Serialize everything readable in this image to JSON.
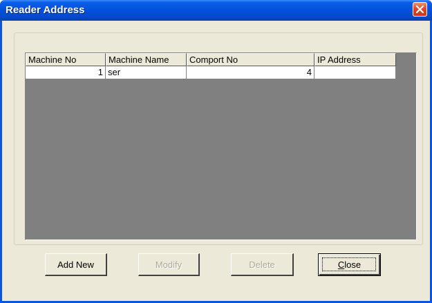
{
  "window": {
    "title": "Reader Address"
  },
  "icons": {
    "close": "close-x-icon"
  },
  "colors": {
    "titlebar": "#0450d8",
    "close_button": "#e0462a",
    "client_bg": "#ece9d8",
    "grid_bg": "#808080"
  },
  "grid": {
    "columns": [
      "Machine No",
      "Machine Name",
      "Comport No",
      "IP Address"
    ],
    "rows": [
      {
        "machine_no": "1",
        "machine_name": "ser",
        "comport_no": "4",
        "ip_address": ""
      }
    ]
  },
  "buttons": {
    "add_new": "Add New",
    "modify": "Modify",
    "delete": "Delete",
    "close_mnemonic": "C",
    "close_rest": "lose"
  }
}
